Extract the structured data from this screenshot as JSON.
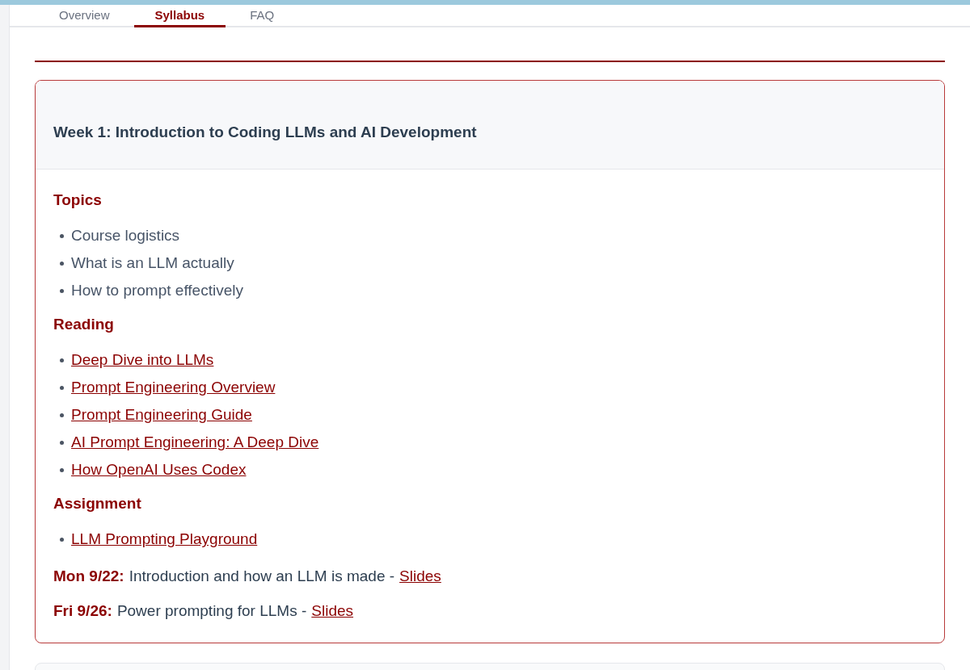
{
  "tabs": [
    {
      "label": "Overview",
      "selected": false
    },
    {
      "label": "Syllabus",
      "selected": true
    },
    {
      "label": "FAQ",
      "selected": false
    }
  ],
  "week": {
    "title": "Week 1: Introduction to Coding LLMs and AI Development",
    "sections": [
      {
        "heading": "Topics",
        "kind": "text",
        "items": [
          "Course logistics",
          "What is an LLM actually",
          "How to prompt effectively"
        ]
      },
      {
        "heading": "Reading",
        "kind": "links",
        "items": [
          "Deep Dive into LLMs",
          "Prompt Engineering Overview",
          "Prompt Engineering Guide",
          "AI Prompt Engineering: A Deep Dive",
          "How OpenAI Uses Codex"
        ]
      },
      {
        "heading": "Assignment",
        "kind": "links",
        "items": [
          "LLM Prompting Playground"
        ]
      }
    ],
    "sessions": [
      {
        "day": "Mon 9/22:",
        "description": "Introduction and how an LLM is made -",
        "link": "Slides"
      },
      {
        "day": "Fri 9/26:",
        "description": "Power prompting for LLMs -",
        "link": "Slides"
      }
    ]
  }
}
